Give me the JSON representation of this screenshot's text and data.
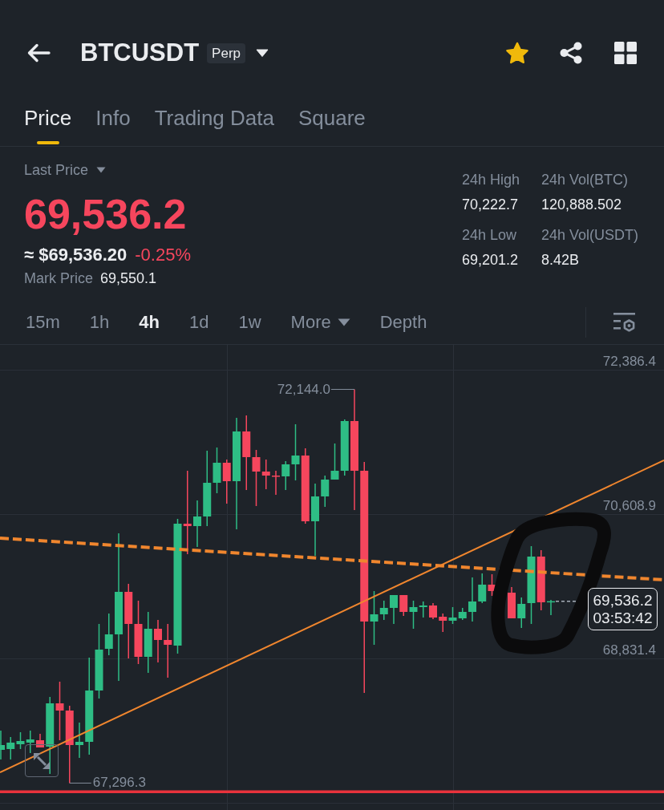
{
  "header": {
    "symbol": "BTCUSDT",
    "contract_badge": "Perp",
    "favorite": true
  },
  "tabs": [
    {
      "label": "Price",
      "selected": true
    },
    {
      "label": "Info",
      "selected": false
    },
    {
      "label": "Trading Data",
      "selected": false
    },
    {
      "label": "Square",
      "selected": false
    }
  ],
  "ticker": {
    "last_price_label": "Last Price",
    "last_price": "69,536.2",
    "falling": true,
    "approx_value": "≈ $69,536.20",
    "change": "-0.25%",
    "mark_price_label": "Mark Price",
    "mark_price": "69,550.1"
  },
  "stats": [
    {
      "label": "24h High",
      "value": "70,222.7"
    },
    {
      "label": "24h Vol(BTC)",
      "value": "120,888.502"
    },
    {
      "label": "24h Low",
      "value": "69,201.2"
    },
    {
      "label": "24h Vol(USDT)",
      "value": "8.42B"
    }
  ],
  "intervals": [
    {
      "label": "15m",
      "kind": "option",
      "selected": false
    },
    {
      "label": "1h",
      "kind": "option",
      "selected": false
    },
    {
      "label": "4h",
      "kind": "option",
      "selected": true
    },
    {
      "label": "1d",
      "kind": "option",
      "selected": false
    },
    {
      "label": "1w",
      "kind": "option",
      "selected": false
    },
    {
      "label": "More",
      "kind": "dropdown",
      "selected": false
    },
    {
      "label": "Depth",
      "kind": "option",
      "selected": false
    }
  ],
  "chart": {
    "chart_data": {
      "type": "candlestick",
      "grid": true,
      "ohlc": [
        [
          67705.7,
          67942.7,
          67587.2,
          67764.9
        ],
        [
          67715.6,
          67863.7,
          67587.2,
          67794.6
        ],
        [
          67774.8,
          67922.9,
          67715.6,
          67814.3
        ],
        [
          67794.6,
          67942.7,
          67666.2,
          67834.1
        ],
        [
          67824.2,
          67903.2,
          67735.3,
          67735.3
        ],
        [
          67745.2,
          68357.4,
          67409.4,
          68278.4
        ],
        [
          68278.4,
          68545.1,
          67824.2,
          68189.6
        ],
        [
          68189.6,
          68248.8,
          67296.3,
          67764.9
        ],
        [
          67764.9,
          68041.4,
          67606.9,
          67804.4
        ],
        [
          67804.4,
          68841.3,
          67646.4,
          68436.4
        ],
        [
          68436.4,
          69256.1,
          68337.7,
          68940.1
        ],
        [
          68949.9,
          69384.4,
          68870.9,
          69127.7
        ],
        [
          69127.7,
          70371.9,
          68554.9,
          69651.1
        ],
        [
          69651.1,
          69749.8,
          68831.4,
          69256.1
        ],
        [
          69256.1,
          69542.4,
          68762.3,
          68851.2
        ],
        [
          68851.2,
          69404.2,
          68653.7,
          69196.8
        ],
        [
          69196.8,
          69305.4,
          68782.1,
          69058.6
        ],
        [
          69058.6,
          69256.1,
          68594.4,
          68999.3
        ],
        [
          68989.4,
          70549.7,
          68890.7,
          70490.4
        ],
        [
          70490.4,
          71142.2,
          70115.2,
          70460.8
        ],
        [
          70460.8,
          70776.8,
          70204.1,
          70579.3
        ],
        [
          70579.3,
          71389.1,
          70460.8,
          70994.1
        ],
        [
          70994.1,
          71428.6,
          70865.7,
          71240.9
        ],
        [
          71240.9,
          71280.4,
          70737.3,
          71013.8
        ],
        [
          71013.8,
          71793.9,
          70421.3,
          71626.1
        ],
        [
          71626.1,
          71823.6,
          70905.2,
          71310.1
        ],
        [
          71310.1,
          71398.9,
          70707.7,
          71132.3
        ],
        [
          71132.3,
          71280.4,
          70915.1,
          71082.9
        ],
        [
          71082.9,
          71142.2,
          70845.9,
          71068.1
        ],
        [
          71073.1,
          71260.7,
          70905.2,
          71221.2
        ],
        [
          71221.2,
          71714.9,
          71023.7,
          71329.8
        ],
        [
          71329.8,
          71418.7,
          70490.4,
          70520.1
        ],
        [
          70520.1,
          70984.2,
          70095.4,
          70826.2
        ],
        [
          70826.2,
          71082.9,
          70697.8,
          71033.6
        ],
        [
          71033.6,
          71477.9,
          71033.6,
          71142.2
        ],
        [
          71142.2,
          71774.2,
          71082.9,
          71754.4
        ],
        [
          71754.4,
          72144.0,
          70658.3,
          71142.2
        ],
        [
          71142.2,
          71250.8,
          68406.8,
          69285.7
        ],
        [
          69285.7,
          69660.9,
          68999.3,
          69374.6
        ],
        [
          69374.6,
          69542.4,
          69305.4,
          69453.6
        ],
        [
          69453.6,
          69611.6,
          69256.1,
          69611.6
        ],
        [
          69611.6,
          69611.6,
          69354.8,
          69404.2
        ],
        [
          69404.2,
          69542.4,
          69196.8,
          69463.4
        ],
        [
          69463.4,
          69532.6,
          69335.1,
          69483.2
        ],
        [
          69483.2,
          69512.8,
          69315.3,
          69335.1
        ],
        [
          69344.9,
          69384.4,
          69157.3,
          69295.6
        ],
        [
          69295.6,
          69463.4,
          69256.1,
          69335.1
        ],
        [
          69325.2,
          69453.6,
          69305.4,
          69404.2
        ],
        [
          69404.2,
          69828.8,
          69285.7,
          69532.6
        ],
        [
          69532.6,
          69878.2,
          69512.8,
          69739.9
        ],
        [
          69739.9,
          69868.3,
          69601.7,
          69660.9
        ],
        null,
        [
          69641.2,
          69710.3,
          69325.2,
          69325.2
        ],
        [
          69325.2,
          69581.9,
          69206.7,
          69502.9
        ],
        [
          69512.8,
          70213.9,
          69256.1,
          70085.6
        ],
        [
          70085.6,
          70164.6,
          69423.9,
          69522.7
        ],
        [
          69530.0,
          69552.3,
          69364.7,
          69536.2
        ]
      ],
      "ylim": [
        66965.0,
        72692.5
      ],
      "yticks": [
        {
          "value": 72386.4,
          "label": "72,386.4"
        },
        {
          "value": 70608.9,
          "label": "70,608.9"
        },
        {
          "value": 68831.4,
          "label": "68,831.4"
        }
      ],
      "annotations": [
        "72,144.0",
        "67,296.3"
      ]
    },
    "last_price": "69,536.2",
    "countdown": "03:53:42"
  }
}
